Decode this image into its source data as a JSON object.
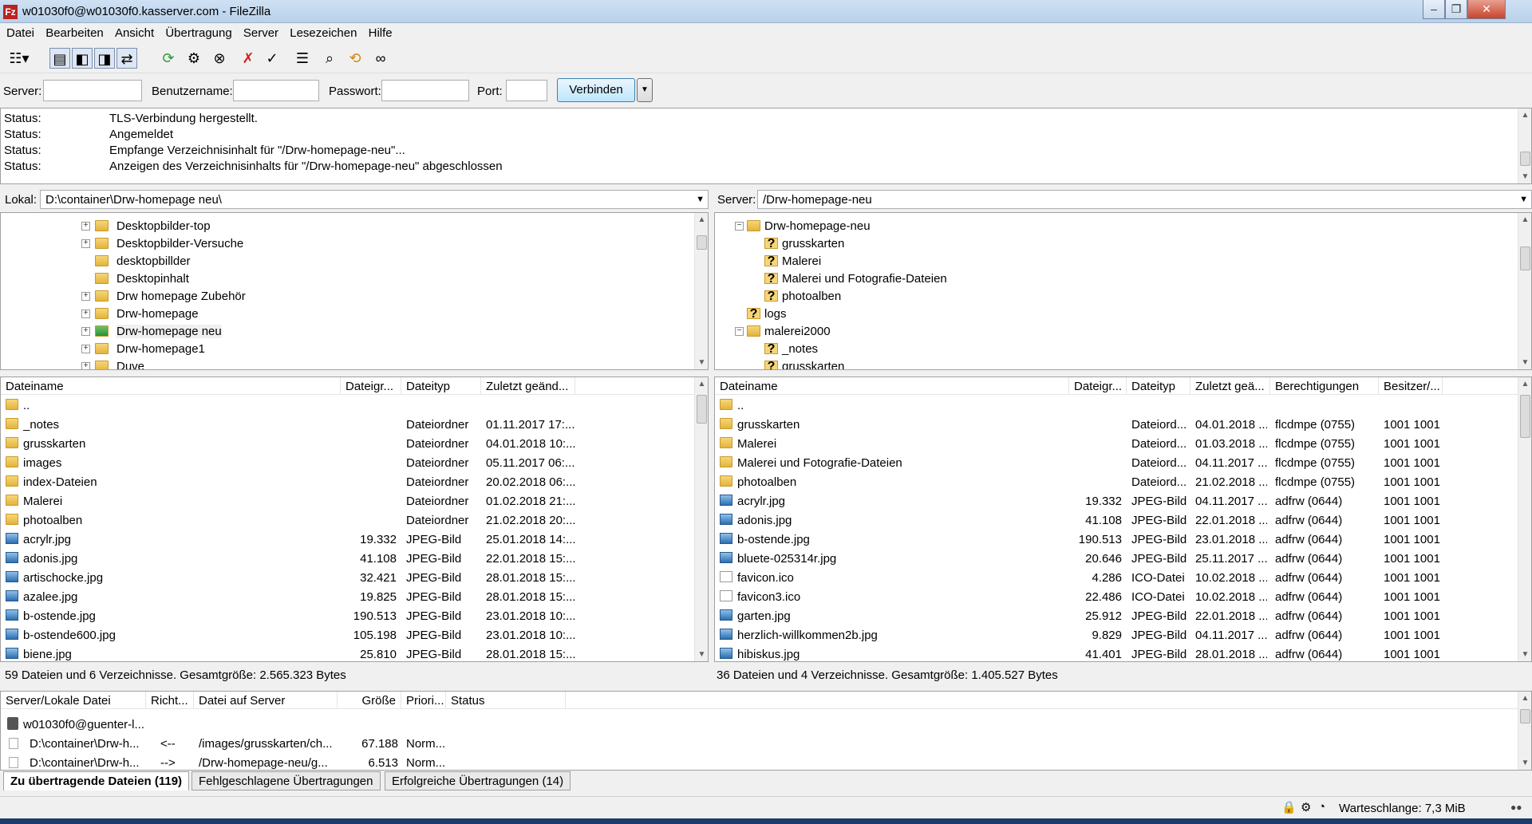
{
  "window": {
    "title": "w01030f0@w01030f0.kasserver.com - FileZilla",
    "app_icon": "Fz"
  },
  "menu": [
    "Datei",
    "Bearbeiten",
    "Ansicht",
    "Übertragung",
    "Server",
    "Lesezeichen",
    "Hilfe"
  ],
  "quickconnect": {
    "server_label": "Server:",
    "server_value": "",
    "user_label": "Benutzername:",
    "user_value": "",
    "pass_label": "Passwort:",
    "pass_value": "",
    "port_label": "Port:",
    "port_value": "",
    "connect_label": "Verbinden"
  },
  "log": [
    {
      "k": "Status:",
      "v": "TLS-Verbindung hergestellt."
    },
    {
      "k": "Status:",
      "v": "Angemeldet"
    },
    {
      "k": "Status:",
      "v": "Empfange Verzeichnisinhalt für \"/Drw-homepage-neu\"..."
    },
    {
      "k": "Status:",
      "v": "Anzeigen des Verzeichnisinhalts für \"/Drw-homepage-neu\" abgeschlossen"
    }
  ],
  "local": {
    "path_label": "Lokal:",
    "path": "D:\\container\\Drw-homepage neu\\",
    "tree": [
      {
        "label": "Desktopbilder-top",
        "expandable": true
      },
      {
        "label": "Desktopbilder-Versuche",
        "expandable": true
      },
      {
        "label": "desktopbillder",
        "expandable": false
      },
      {
        "label": "Desktopinhalt",
        "expandable": false
      },
      {
        "label": "Drw homepage Zubehör",
        "expandable": true
      },
      {
        "label": "Drw-homepage",
        "expandable": true
      },
      {
        "label": "Drw-homepage neu",
        "expandable": true,
        "selected": true
      },
      {
        "label": "Drw-homepage1",
        "expandable": true
      },
      {
        "label": "Duve",
        "expandable": true
      }
    ],
    "columns": [
      "Dateiname",
      "Dateigr...",
      "Dateityp",
      "Zuletzt geänd..."
    ],
    "files": [
      {
        "name": "..",
        "size": "",
        "type": "",
        "date": "",
        "kind": "folder"
      },
      {
        "name": "_notes",
        "size": "",
        "type": "Dateiordner",
        "date": "01.11.2017 17:...",
        "kind": "folder"
      },
      {
        "name": "grusskarten",
        "size": "",
        "type": "Dateiordner",
        "date": "04.01.2018 10:...",
        "kind": "folder"
      },
      {
        "name": "images",
        "size": "",
        "type": "Dateiordner",
        "date": "05.11.2017 06:...",
        "kind": "folder"
      },
      {
        "name": "index-Dateien",
        "size": "",
        "type": "Dateiordner",
        "date": "20.02.2018 06:...",
        "kind": "folder"
      },
      {
        "name": "Malerei",
        "size": "",
        "type": "Dateiordner",
        "date": "01.02.2018 21:...",
        "kind": "folder"
      },
      {
        "name": "photoalben",
        "size": "",
        "type": "Dateiordner",
        "date": "21.02.2018 20:...",
        "kind": "folder"
      },
      {
        "name": "acrylr.jpg",
        "size": "19.332",
        "type": "JPEG-Bild",
        "date": "25.01.2018 14:...",
        "kind": "img"
      },
      {
        "name": "adonis.jpg",
        "size": "41.108",
        "type": "JPEG-Bild",
        "date": "22.01.2018 15:...",
        "kind": "img"
      },
      {
        "name": "artischocke.jpg",
        "size": "32.421",
        "type": "JPEG-Bild",
        "date": "28.01.2018 15:...",
        "kind": "img"
      },
      {
        "name": "azalee.jpg",
        "size": "19.825",
        "type": "JPEG-Bild",
        "date": "28.01.2018 15:...",
        "kind": "img"
      },
      {
        "name": "b-ostende.jpg",
        "size": "190.513",
        "type": "JPEG-Bild",
        "date": "23.01.2018 10:...",
        "kind": "img"
      },
      {
        "name": "b-ostende600.jpg",
        "size": "105.198",
        "type": "JPEG-Bild",
        "date": "23.01.2018 10:...",
        "kind": "img"
      },
      {
        "name": "biene.jpg",
        "size": "25.810",
        "type": "JPEG-Bild",
        "date": "28.01.2018 15:...",
        "kind": "img"
      }
    ],
    "summary": "59 Dateien und 6 Verzeichnisse. Gesamtgröße: 2.565.323 Bytes"
  },
  "remote": {
    "path_label": "Server:",
    "path": "/Drw-homepage-neu",
    "tree": [
      {
        "label": "Drw-homepage-neu",
        "level": 0,
        "expander": "minus",
        "icon": "folder"
      },
      {
        "label": "grusskarten",
        "level": 1,
        "expander": "",
        "icon": "q"
      },
      {
        "label": "Malerei",
        "level": 1,
        "expander": "",
        "icon": "q"
      },
      {
        "label": "Malerei und Fotografie-Dateien",
        "level": 1,
        "expander": "",
        "icon": "q"
      },
      {
        "label": "photoalben",
        "level": 1,
        "expander": "",
        "icon": "q"
      },
      {
        "label": "logs",
        "level": 0,
        "expander": "",
        "icon": "q"
      },
      {
        "label": "malerei2000",
        "level": 0,
        "expander": "minus",
        "icon": "folder"
      },
      {
        "label": "_notes",
        "level": 1,
        "expander": "",
        "icon": "q"
      },
      {
        "label": "grusskarten",
        "level": 1,
        "expander": "",
        "icon": "q"
      }
    ],
    "columns": [
      "Dateiname",
      "Dateigr...",
      "Dateityp",
      "Zuletzt geä...",
      "Berechtigungen",
      "Besitzer/..."
    ],
    "files": [
      {
        "name": "..",
        "size": "",
        "type": "",
        "date": "",
        "perm": "",
        "owner": "",
        "kind": "folder"
      },
      {
        "name": "grusskarten",
        "size": "",
        "type": "Dateiord...",
        "date": "04.01.2018 ...",
        "perm": "flcdmpe (0755)",
        "owner": "1001 1001",
        "kind": "folder"
      },
      {
        "name": "Malerei",
        "size": "",
        "type": "Dateiord...",
        "date": "01.03.2018 ...",
        "perm": "flcdmpe (0755)",
        "owner": "1001 1001",
        "kind": "folder"
      },
      {
        "name": "Malerei und Fotografie-Dateien",
        "size": "",
        "type": "Dateiord...",
        "date": "04.11.2017 ...",
        "perm": "flcdmpe (0755)",
        "owner": "1001 1001",
        "kind": "folder"
      },
      {
        "name": "photoalben",
        "size": "",
        "type": "Dateiord...",
        "date": "21.02.2018 ...",
        "perm": "flcdmpe (0755)",
        "owner": "1001 1001",
        "kind": "folder"
      },
      {
        "name": "acrylr.jpg",
        "size": "19.332",
        "type": "JPEG-Bild",
        "date": "04.11.2017 ...",
        "perm": "adfrw (0644)",
        "owner": "1001 1001",
        "kind": "img"
      },
      {
        "name": "adonis.jpg",
        "size": "41.108",
        "type": "JPEG-Bild",
        "date": "22.01.2018 ...",
        "perm": "adfrw (0644)",
        "owner": "1001 1001",
        "kind": "img"
      },
      {
        "name": "b-ostende.jpg",
        "size": "190.513",
        "type": "JPEG-Bild",
        "date": "23.01.2018 ...",
        "perm": "adfrw (0644)",
        "owner": "1001 1001",
        "kind": "img"
      },
      {
        "name": "bluete-025314r.jpg",
        "size": "20.646",
        "type": "JPEG-Bild",
        "date": "25.11.2017 ...",
        "perm": "adfrw (0644)",
        "owner": "1001 1001",
        "kind": "img"
      },
      {
        "name": "favicon.ico",
        "size": "4.286",
        "type": "ICO-Datei",
        "date": "10.02.2018 ...",
        "perm": "adfrw (0644)",
        "owner": "1001 1001",
        "kind": "ico"
      },
      {
        "name": "favicon3.ico",
        "size": "22.486",
        "type": "ICO-Datei",
        "date": "10.02.2018 ...",
        "perm": "adfrw (0644)",
        "owner": "1001 1001",
        "kind": "ico"
      },
      {
        "name": "garten.jpg",
        "size": "25.912",
        "type": "JPEG-Bild",
        "date": "22.01.2018 ...",
        "perm": "adfrw (0644)",
        "owner": "1001 1001",
        "kind": "img"
      },
      {
        "name": "herzlich-willkommen2b.jpg",
        "size": "9.829",
        "type": "JPEG-Bild",
        "date": "04.11.2017 ...",
        "perm": "adfrw (0644)",
        "owner": "1001 1001",
        "kind": "img"
      },
      {
        "name": "hibiskus.jpg",
        "size": "41.401",
        "type": "JPEG-Bild",
        "date": "28.01.2018 ...",
        "perm": "adfrw (0644)",
        "owner": "1001 1001",
        "kind": "img"
      }
    ],
    "summary": "36 Dateien und 4 Verzeichnisse. Gesamtgröße: 1.405.527 Bytes"
  },
  "queue": {
    "columns": [
      "Server/Lokale Datei",
      "Richt...",
      "Datei auf Server",
      "Größe",
      "Priori...",
      "Status"
    ],
    "server_row": "w01030f0@guenter-l...",
    "rows": [
      {
        "local": "D:\\container\\Drw-h...",
        "dir": "<--",
        "remote": "/images/grusskarten/ch...",
        "size": "67.188",
        "prio": "Norm...",
        "status": ""
      },
      {
        "local": "D:\\container\\Drw-h...",
        "dir": "-->",
        "remote": "/Drw-homepage-neu/g...",
        "size": "6.513",
        "prio": "Norm...",
        "status": ""
      }
    ],
    "tabs": [
      "Zu übertragende Dateien (119)",
      "Fehlgeschlagene Übertragungen",
      "Erfolgreiche Übertragungen (14)"
    ]
  },
  "statusbar": {
    "queue_text": "Warteschlange: 7,3 MiB"
  },
  "colors": {
    "accent": "#3c7fb1",
    "folder": "#e4b43c",
    "titlebar": "#b9d1ea"
  }
}
